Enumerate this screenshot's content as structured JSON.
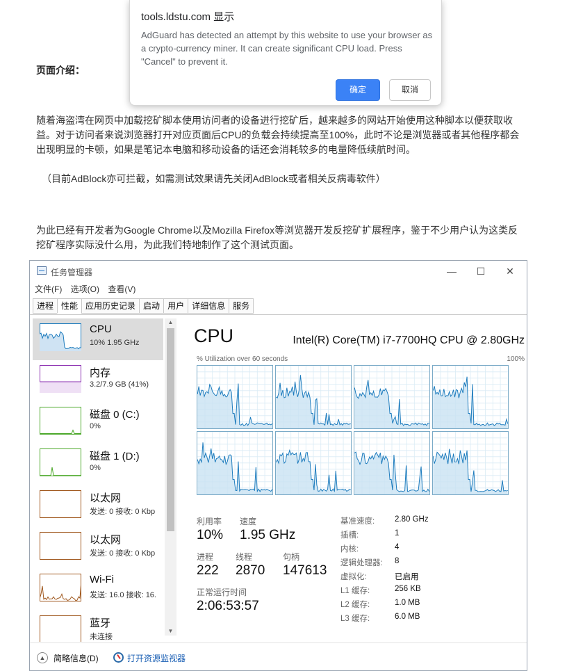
{
  "article": {
    "section_title": "页面介绍：",
    "p1": "随着海盗湾在网页中加载挖矿脚本使用访问者的设备进行挖矿后，越来越多的网站开始使用这种脚本以便获取收益。对于访问者来说浏览器打开对应页面后CPU的负载会持续提高至100%，此时不论是浏览器或者其他程序都会出现明显的卡顿，如果是笔记本电脑和移动设备的话还会消耗较多的电量降低续航时间。",
    "p2": "（目前AdBlock亦可拦截，如需测试效果请先关闭AdBlock或者相关反病毒软件）",
    "p3": "为此已经有开发者为Google Chrome以及Mozilla Firefox等浏览器开发反挖矿扩展程序，鉴于不少用户认为这类反挖矿程序实际没什么用，为此我们特地制作了这个测试页面。"
  },
  "dialog": {
    "title": "tools.ldstu.com 显示",
    "message": "AdGuard has detected an attempt by this website to use your browser as a crypto-currency miner. It can create significant CPU load. Press \"Cancel\" to prevent it.",
    "ok_label": "确定",
    "cancel_label": "取消",
    "accent_color": "#3b82f6"
  },
  "task_manager": {
    "title": "任务管理器",
    "window_controls": {
      "minimize": "—",
      "maximize": "☐",
      "close": "✕"
    },
    "menu": [
      "文件(F)",
      "选项(O)",
      "查看(V)"
    ],
    "tabs": [
      "进程",
      "性能",
      "应用历史记录",
      "启动",
      "用户",
      "详细信息",
      "服务"
    ],
    "active_tab": "性能",
    "sidebar": [
      {
        "name": "CPU",
        "sub": "10%  1.95 GHz",
        "color": "#1c7bbd",
        "selected": true
      },
      {
        "name": "内存",
        "sub": "3.2/7.9 GB (41%)",
        "color": "#8b2fb0"
      },
      {
        "name": "磁盘 0 (C:)",
        "sub": "0%",
        "color": "#4ca82a"
      },
      {
        "name": "磁盘 1 (D:)",
        "sub": "0%",
        "color": "#4ca82a"
      },
      {
        "name": "以太网",
        "sub": "发送: 0 接收: 0 Kbp",
        "color": "#a0581e"
      },
      {
        "name": "以太网",
        "sub": "发送: 0 接收: 0 Kbp",
        "color": "#a0581e"
      },
      {
        "name": "Wi-Fi",
        "sub": "发送: 16.0  接收: 16.",
        "color": "#a0581e"
      },
      {
        "name": "蓝牙",
        "sub": "未连接",
        "color": "#a0581e"
      }
    ],
    "detail": {
      "heading": "CPU",
      "model": "Intel(R) Core(TM) i7-7700HQ CPU @ 2.80GHz",
      "util_label": "% Utilization over 60 seconds",
      "util_max": "100%",
      "graph_color": "#1c7bbd"
    },
    "stats": {
      "util_label": "利用率",
      "util_value": "10%",
      "speed_label": "速度",
      "speed_value": "1.95 GHz",
      "proc_label": "进程",
      "proc_value": "222",
      "thread_label": "线程",
      "thread_value": "2870",
      "handle_label": "句柄",
      "handle_value": "147613",
      "uptime_label": "正常运行时间",
      "uptime_value": "2:06:53:57"
    },
    "right_stats": [
      {
        "label": "基准速度:",
        "value": "2.80 GHz"
      },
      {
        "label": "插槽:",
        "value": "1"
      },
      {
        "label": "内核:",
        "value": "4"
      },
      {
        "label": "逻辑处理器:",
        "value": "8"
      },
      {
        "label": "虚拟化:",
        "value": "已启用"
      },
      {
        "label": "L1 缓存:",
        "value": "256 KB"
      },
      {
        "label": "L2 缓存:",
        "value": "1.0 MB"
      },
      {
        "label": "L3 缓存:",
        "value": "6.0 MB"
      }
    ],
    "footer": {
      "fewer_details": "简略信息(D)",
      "resource_monitor": "打开资源监视器"
    }
  }
}
